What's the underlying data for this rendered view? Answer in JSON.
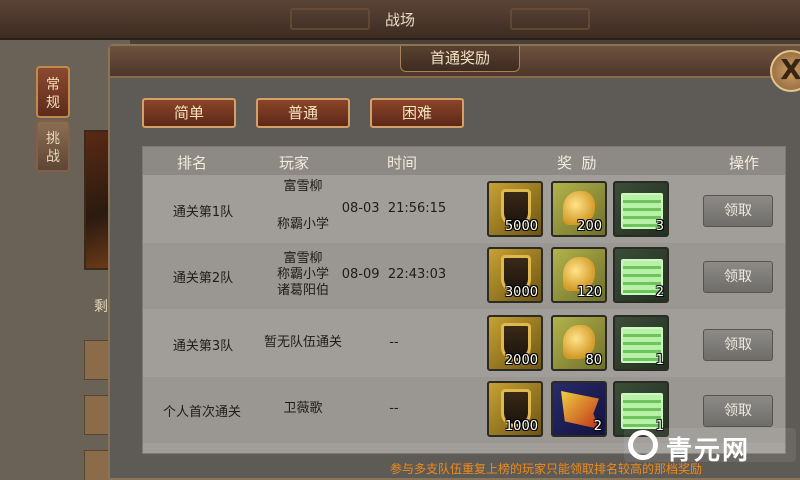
{
  "screen_title": "战场",
  "side_tabs": [
    {
      "label": "常\n规"
    },
    {
      "label": "挑\n战"
    }
  ],
  "background_partial_char": "剩",
  "dialog": {
    "title": "首通奖励",
    "close_label": "X"
  },
  "difficulty_buttons": [
    "简单",
    "普通",
    "困难"
  ],
  "table": {
    "headers": {
      "rank": "排名",
      "player": "玩家",
      "time": "时间",
      "reward": "奖  励",
      "action": "操作"
    },
    "rows": [
      {
        "rank": "通关第1队",
        "players": [
          "富雪柳",
          "",
          "称霸小学"
        ],
        "time": "08-03  21:56:15",
        "rewards": [
          {
            "icon": "shield-item",
            "qty": "5000"
          },
          {
            "icon": "golden-ear-item",
            "qty": "200"
          },
          {
            "icon": "green-crate-item",
            "qty": "3"
          }
        ],
        "action": "领取"
      },
      {
        "rank": "通关第2队",
        "players": [
          "富雪柳",
          "称霸小学",
          "诸葛阳伯"
        ],
        "time": "08-09  22:43:03",
        "rewards": [
          {
            "icon": "shield-item",
            "qty": "3000"
          },
          {
            "icon": "golden-ear-item",
            "qty": "120"
          },
          {
            "icon": "green-crate-item",
            "qty": "2"
          }
        ],
        "action": "领取"
      },
      {
        "rank": "通关第3队",
        "players": [
          "暂无队伍通关"
        ],
        "time": "--",
        "rewards": [
          {
            "icon": "shield-item",
            "qty": "2000"
          },
          {
            "icon": "golden-ear-item",
            "qty": "80"
          },
          {
            "icon": "green-crate-item",
            "qty": "1"
          }
        ],
        "action": "领取"
      },
      {
        "rank": "个人首次通关",
        "players": [
          "卫薇歌"
        ],
        "time": "--",
        "rewards": [
          {
            "icon": "shield-item",
            "qty": "1000"
          },
          {
            "icon": "war-flag-item",
            "qty": "2"
          },
          {
            "icon": "green-crate-item",
            "qty": "1"
          }
        ],
        "action": "领取"
      }
    ]
  },
  "footer_note": "参与多支队伍重复上榜的玩家只能领取排名较高的那档奖励",
  "watermark": "青元网",
  "colors": {
    "footer_note": "#f08a1a",
    "difficulty_button": "#8a4528",
    "claim_button": "#7d7c79"
  }
}
